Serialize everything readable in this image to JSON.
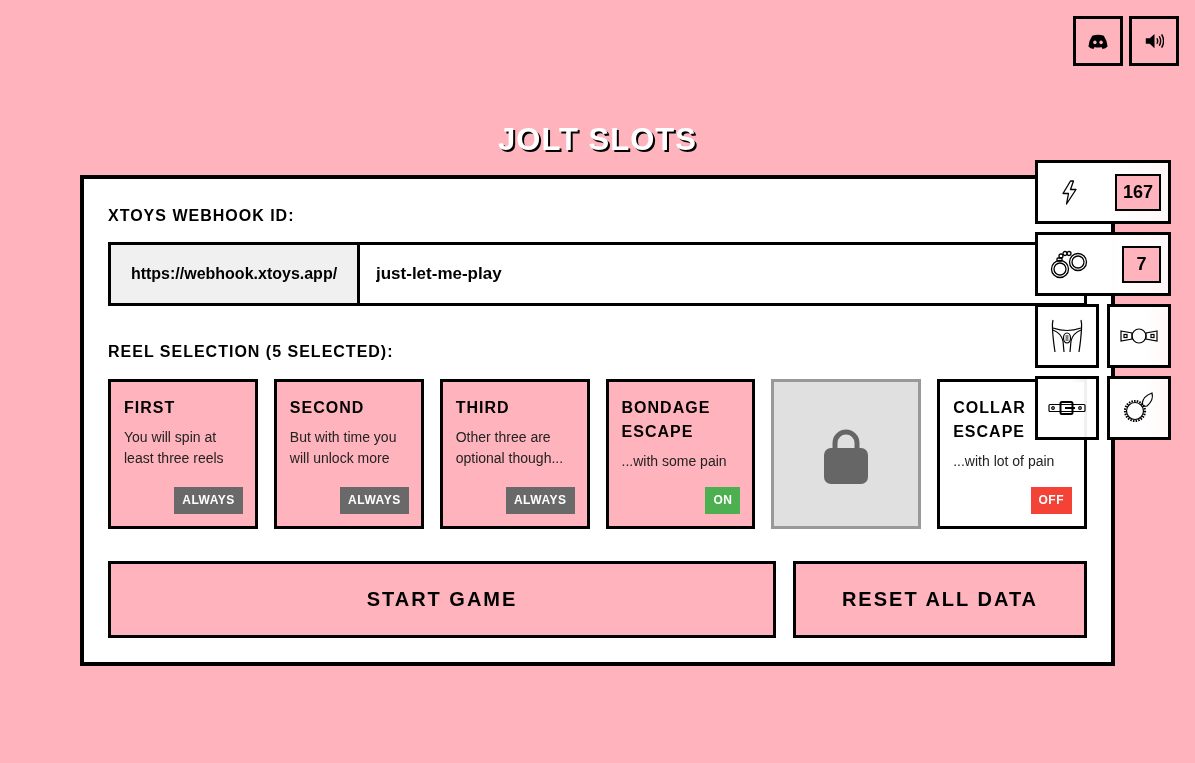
{
  "title": "JOLT SLOTS",
  "webhook": {
    "label": "XTOYS WEBHOOK ID:",
    "prefix": "https://webhook.xtoys.app/",
    "value": "just-let-me-play"
  },
  "reel_selection": {
    "label": "REEL SELECTION (5 SELECTED):",
    "reels": [
      {
        "kind": "always",
        "title": "FIRST",
        "description": "You will spin at least three reels",
        "badge": "ALWAYS",
        "selected": true
      },
      {
        "kind": "always",
        "title": "SECOND",
        "description": "But with time you will unlock more",
        "badge": "ALWAYS",
        "selected": true
      },
      {
        "kind": "always",
        "title": "THIRD",
        "description": "Other three are optional though...",
        "badge": "ALWAYS",
        "selected": true
      },
      {
        "kind": "toggle",
        "title": "BONDAGE ESCAPE",
        "description": "...with some pain",
        "badge": "ON",
        "selected": true
      },
      {
        "kind": "locked",
        "selected": false
      },
      {
        "kind": "toggle",
        "title": "COLLAR ESCAPE",
        "description": "...with lot of pain",
        "badge": "OFF",
        "selected": false
      }
    ]
  },
  "buttons": [
    {
      "label": "START GAME"
    },
    {
      "label": "RESET ALL DATA"
    }
  ],
  "inventory": {
    "counters": [
      {
        "value": "167"
      },
      {
        "value": "7"
      }
    ]
  }
}
